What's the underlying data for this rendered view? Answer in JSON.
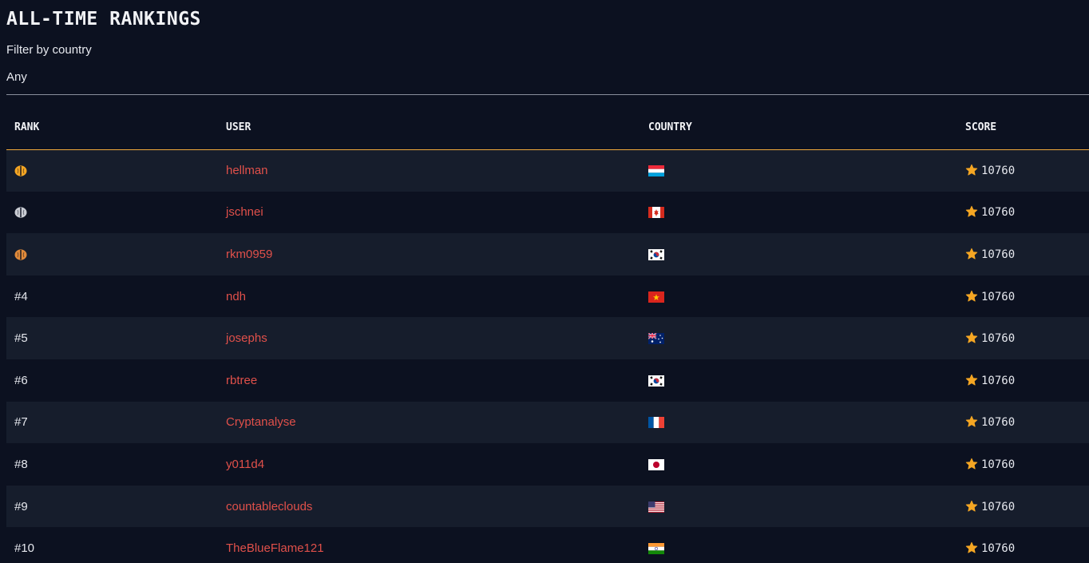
{
  "page": {
    "title": "ALL-TIME RANKINGS",
    "filter_label": "Filter by country",
    "filter_value": "Any"
  },
  "table": {
    "headers": {
      "rank": "RANK",
      "user": "USER",
      "country": "COUNTRY",
      "score": "SCORE"
    },
    "rows": [
      {
        "rank": "",
        "medal": "gold-medal-icon",
        "user": "hellman",
        "flag": "luxembourg-flag-icon",
        "score": "10760"
      },
      {
        "rank": "",
        "medal": "silver-medal-icon",
        "user": "jschnei",
        "flag": "canada-flag-icon",
        "score": "10760"
      },
      {
        "rank": "",
        "medal": "bronze-medal-icon",
        "user": "rkm0959",
        "flag": "south-korea-flag-icon",
        "score": "10760"
      },
      {
        "rank": "#4",
        "medal": "",
        "user": "ndh",
        "flag": "vietnam-flag-icon",
        "score": "10760"
      },
      {
        "rank": "#5",
        "medal": "",
        "user": "josephs",
        "flag": "australia-flag-icon",
        "score": "10760"
      },
      {
        "rank": "#6",
        "medal": "",
        "user": "rbtree",
        "flag": "south-korea-flag-icon",
        "score": "10760"
      },
      {
        "rank": "#7",
        "medal": "",
        "user": "Cryptanalyse",
        "flag": "france-flag-icon",
        "score": "10760"
      },
      {
        "rank": "#8",
        "medal": "",
        "user": "y011d4",
        "flag": "japan-flag-icon",
        "score": "10760"
      },
      {
        "rank": "#9",
        "medal": "",
        "user": "countableclouds",
        "flag": "usa-flag-icon",
        "score": "10760"
      },
      {
        "rank": "#10",
        "medal": "",
        "user": "TheBlueFlame121",
        "flag": "india-flag-icon",
        "score": "10760"
      }
    ]
  },
  "colors": {
    "background": "#0c1120",
    "row_alt": "#161d2c",
    "accent": "#f2a93b",
    "user_link": "#e0504a",
    "gold": "#f5a623",
    "silver": "#c9ccd3",
    "bronze": "#e08a3a"
  }
}
